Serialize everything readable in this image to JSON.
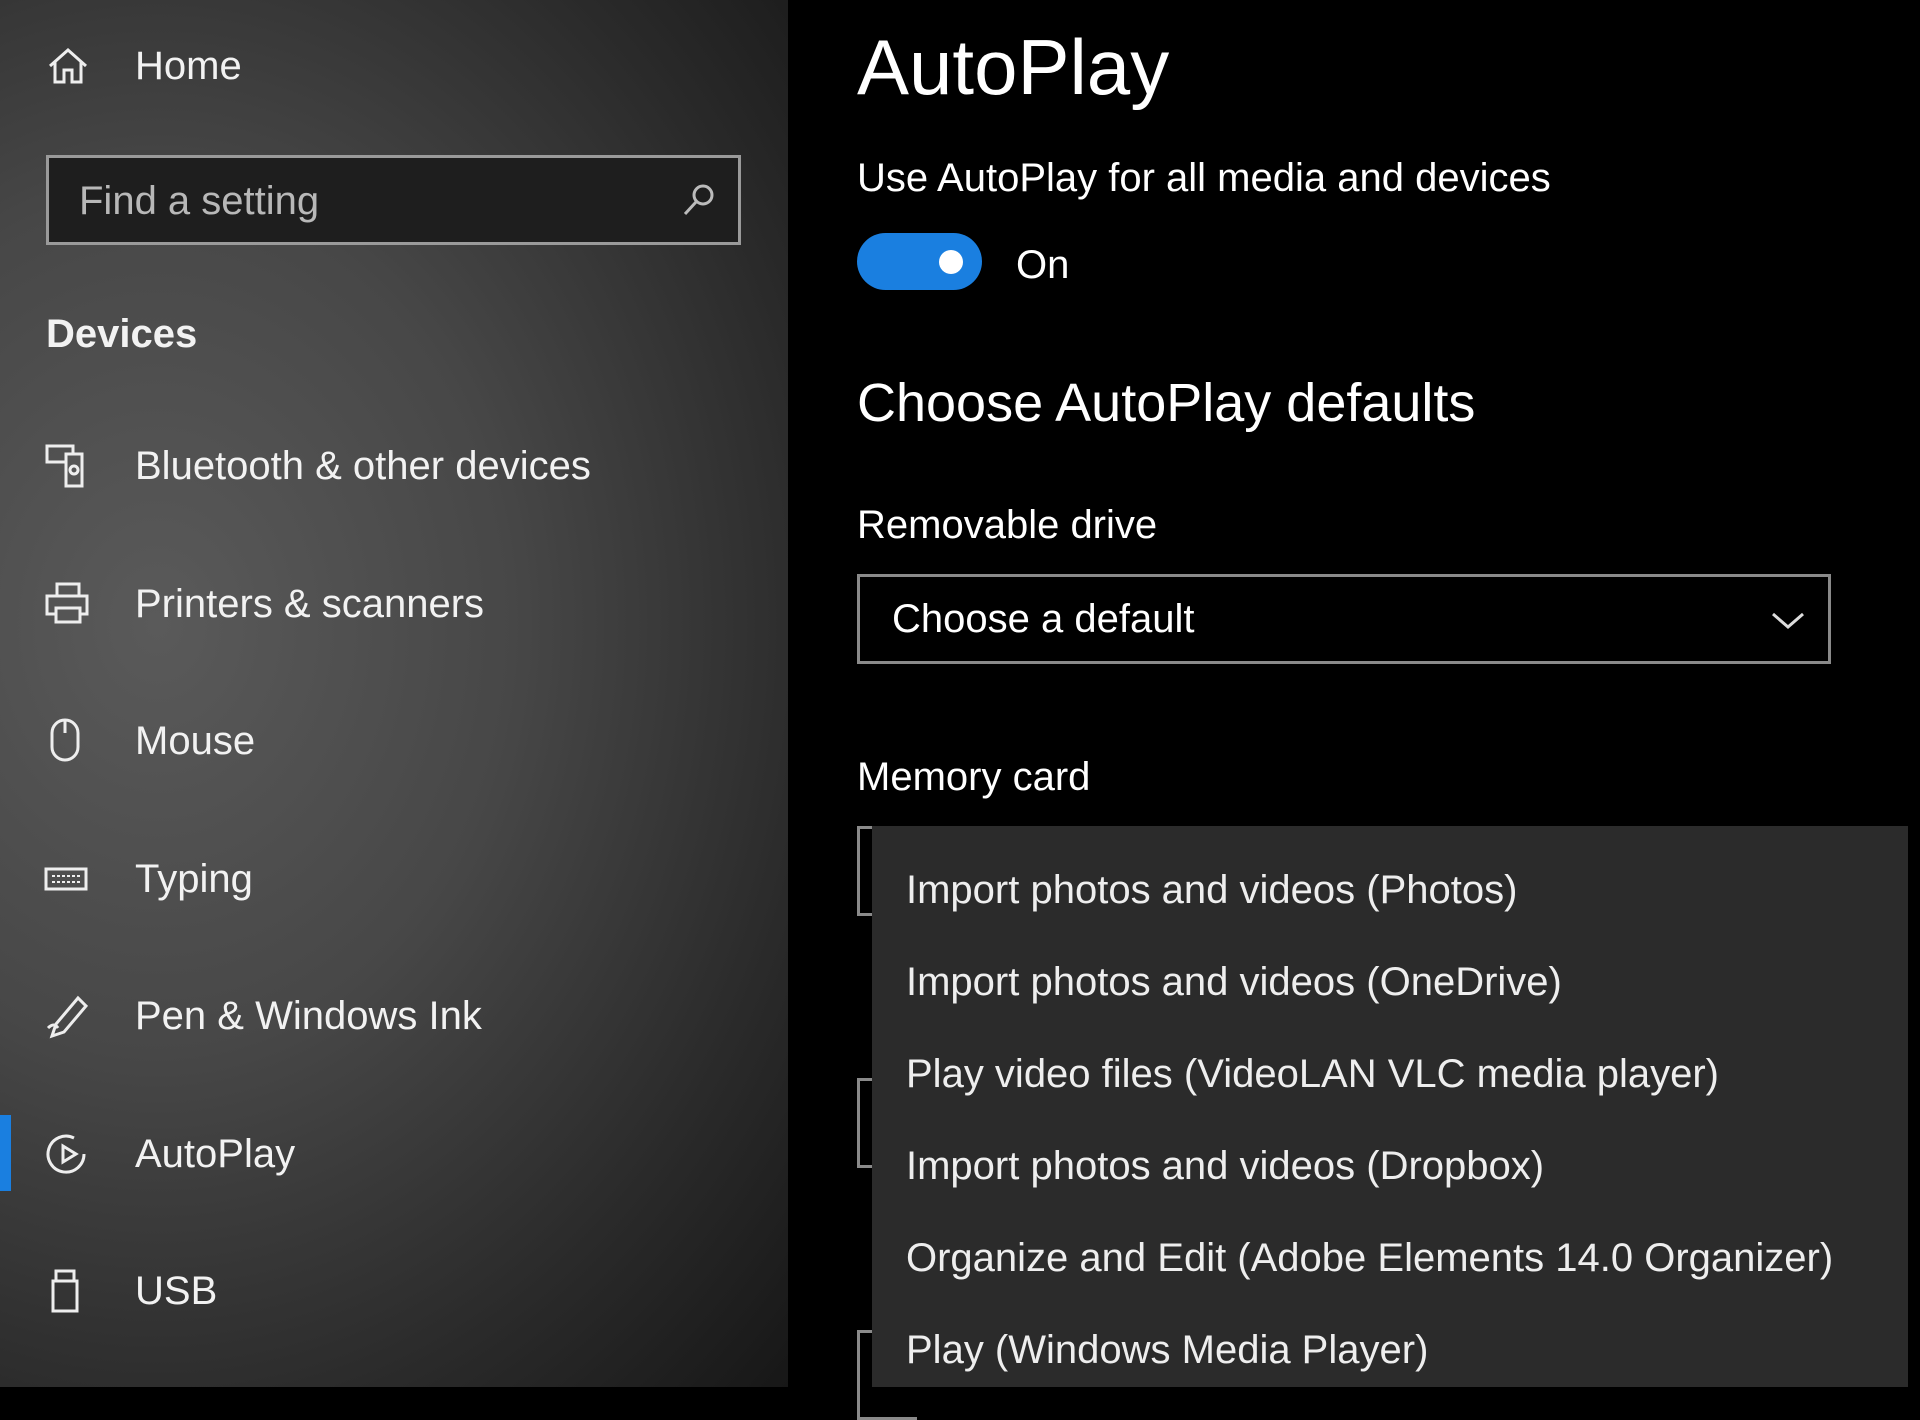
{
  "sidebar": {
    "home": "Home",
    "search_placeholder": "Find a setting",
    "section": "Devices",
    "items": [
      {
        "label": "Bluetooth & other devices",
        "icon": "bluetooth-devices-icon"
      },
      {
        "label": "Printers & scanners",
        "icon": "printer-icon"
      },
      {
        "label": "Mouse",
        "icon": "mouse-icon"
      },
      {
        "label": "Typing",
        "icon": "keyboard-icon"
      },
      {
        "label": "Pen & Windows Ink",
        "icon": "pen-icon"
      },
      {
        "label": "AutoPlay",
        "icon": "autoplay-icon",
        "selected": true
      },
      {
        "label": "USB",
        "icon": "usb-icon"
      }
    ]
  },
  "main": {
    "title": "AutoPlay",
    "toggle_label": "Use AutoPlay for all media and devices",
    "toggle_state": "On",
    "toggle_on": true,
    "defaults_heading": "Choose AutoPlay defaults",
    "removable_label": "Removable drive",
    "removable_value": "Choose a default",
    "memory_label": "Memory card",
    "menu_options": [
      "Import photos and videos (Photos)",
      "Import photos and videos (OneDrive)",
      "Play video files (VideoLAN VLC media player)",
      "Import photos and videos (Dropbox)",
      "Organize and Edit (Adobe Elements 14.0 Organizer)",
      "Play (Windows Media Player)"
    ]
  },
  "colors": {
    "accent": "#1a7fe0",
    "menu_bg": "#2b2b2b"
  }
}
